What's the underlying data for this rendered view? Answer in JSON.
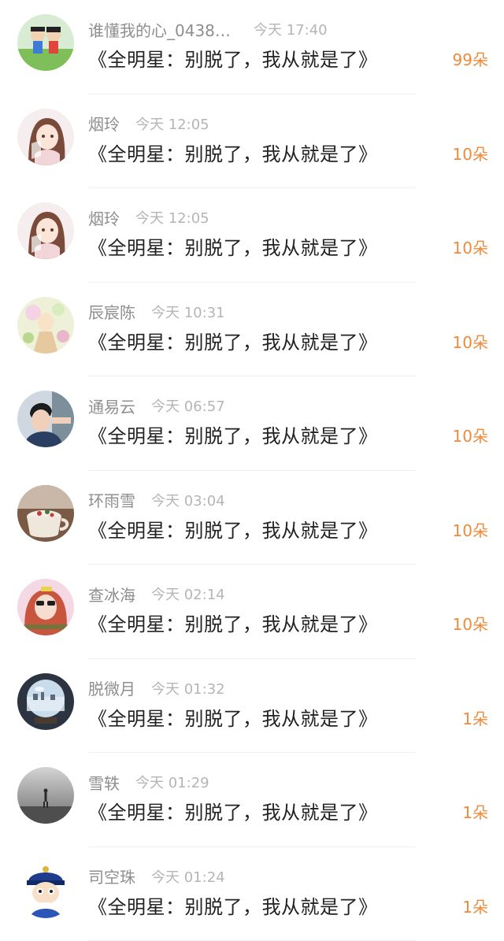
{
  "colors": {
    "count": "#ef8a3a",
    "username": "#8e8e8e",
    "time": "#b5b5b5",
    "gift": "#222222"
  },
  "items": [
    {
      "user": "谁懂我的心_04383...",
      "time": "今天 17:40",
      "gift": "《全明星：别脱了，我从就是了》",
      "count": "99朵",
      "avatar": "cartoon-kids-avatar"
    },
    {
      "user": "烟玲",
      "time": "今天 12:05",
      "gift": "《全明星：别脱了，我从就是了》",
      "count": "10朵",
      "avatar": "anime-girl-avatar"
    },
    {
      "user": "烟玲",
      "time": "今天 12:05",
      "gift": "《全明星：别脱了，我从就是了》",
      "count": "10朵",
      "avatar": "anime-girl-avatar"
    },
    {
      "user": "辰宸陈",
      "time": "今天 10:31",
      "gift": "《全明星：别脱了，我从就是了》",
      "count": "10朵",
      "avatar": "fairy-illustration-avatar"
    },
    {
      "user": "通易云",
      "time": "今天 06:57",
      "gift": "《全明星：别脱了，我从就是了》",
      "count": "10朵",
      "avatar": "young-man-avatar"
    },
    {
      "user": "环雨雪",
      "time": "今天 03:04",
      "gift": "《全明星：别脱了，我从就是了》",
      "count": "10朵",
      "avatar": "coffee-cup-avatar"
    },
    {
      "user": "查冰海",
      "time": "今天 02:14",
      "gift": "《全明星：别脱了，我从就是了》",
      "count": "10朵",
      "avatar": "girl-sunglasses-avatar"
    },
    {
      "user": "脱微月",
      "time": "今天 01:32",
      "gift": "《全明星：别脱了，我从就是了》",
      "count": "1朵",
      "avatar": "crystal-ball-avatar"
    },
    {
      "user": "雪轶",
      "time": "今天 01:29",
      "gift": "《全明星：别脱了，我从就是了》",
      "count": "1朵",
      "avatar": "foggy-figure-avatar"
    },
    {
      "user": "司空珠",
      "time": "今天 01:24",
      "gift": "《全明星：别脱了，我从就是了》",
      "count": "1朵",
      "avatar": "cartoon-official-avatar"
    }
  ]
}
